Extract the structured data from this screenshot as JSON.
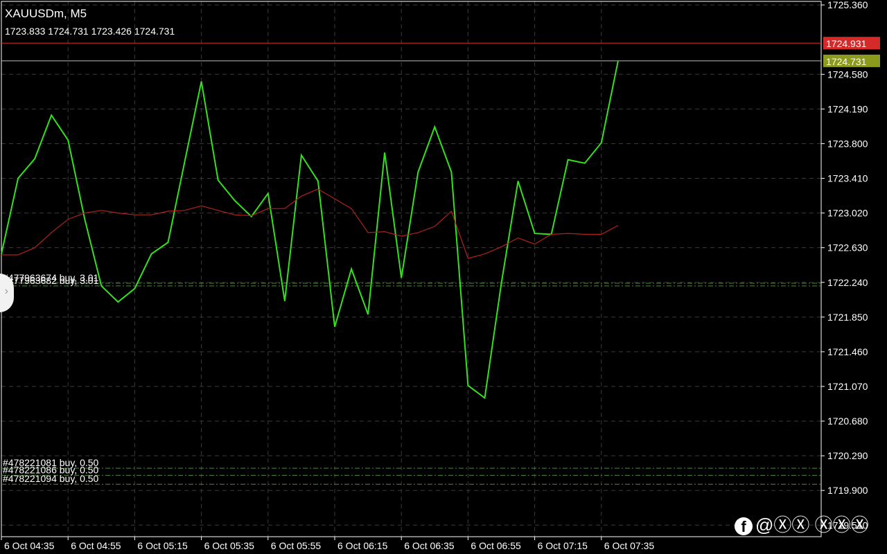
{
  "header": {
    "symbol_timeframe": "XAUUSDm, M5",
    "ohlc": "1723.833 1724.731 1723.426 1724.731"
  },
  "watermark": {
    "fb_glyph": "f",
    "text": "@ⓍⓍ ⓍⓍⓍ"
  },
  "price_tags": [
    {
      "label": "1724.931",
      "value": 1724.931,
      "color": "#d42a2a"
    },
    {
      "label": "1724.731",
      "value": 1724.731,
      "color": "#8c9a1e"
    }
  ],
  "orders": [
    {
      "label": "#477963674 buy, 3.01",
      "price": 1722.23
    },
    {
      "label": "#477963682 buy, 3.01",
      "price": 1722.2
    },
    {
      "label": "#478221081 buy, 0.50",
      "price": 1720.15
    },
    {
      "label": "#478221086 buy, 0.50",
      "price": 1720.07
    },
    {
      "label": "#478221094 buy, 0.50",
      "price": 1719.97
    }
  ],
  "colors": {
    "price_line": "#33e31a",
    "moving_average": "#b2221c",
    "grid": "#3a3a3a",
    "axis": "#ffffff",
    "order_line": "#4e8a3c"
  },
  "chart_data": {
    "type": "line",
    "ylim": [
      1719.38,
      1725.4
    ],
    "y_ticks": [
      "1725.360",
      "1724.580",
      "1724.190",
      "1723.800",
      "1723.410",
      "1723.020",
      "1722.630",
      "1722.240",
      "1721.850",
      "1721.460",
      "1721.070",
      "1720.680",
      "1720.290",
      "1719.900",
      "1719.510"
    ],
    "x_labels": [
      "6 Oct 04:35",
      "6 Oct 04:55",
      "6 Oct 05:15",
      "6 Oct 05:35",
      "6 Oct 05:55",
      "6 Oct 06:15",
      "6 Oct 06:35",
      "6 Oct 06:55",
      "6 Oct 07:15",
      "6 Oct 07:35"
    ],
    "series": [
      {
        "values": [
          1722.56,
          1723.41,
          1723.63,
          1724.12,
          1723.84,
          1722.95,
          1722.2,
          1722.02,
          1722.17,
          1722.56,
          1722.69,
          1723.6,
          1724.5,
          1723.39,
          1723.16,
          1722.98,
          1723.24,
          1722.03,
          1723.67,
          1723.38,
          1721.74,
          1722.39,
          1721.88,
          1723.7,
          1722.29,
          1723.48,
          1723.99,
          1723.48,
          1721.08,
          1720.94,
          1722.23,
          1723.38,
          1722.79,
          1722.78,
          1723.62,
          1723.58,
          1723.81,
          1724.73
        ]
      },
      {
        "values": [
          1722.55,
          1722.55,
          1722.63,
          1722.8,
          1722.95,
          1723.02,
          1723.05,
          1723.02,
          1723.0,
          1723.0,
          1723.04,
          1723.05,
          1723.1,
          1723.05,
          1723.0,
          1722.99,
          1723.07,
          1723.07,
          1723.21,
          1723.29,
          1723.18,
          1723.07,
          1722.8,
          1722.81,
          1722.76,
          1722.8,
          1722.87,
          1723.04,
          1722.51,
          1722.56,
          1722.64,
          1722.74,
          1722.67,
          1722.78,
          1722.79,
          1722.78,
          1722.78,
          1722.88
        ]
      }
    ]
  }
}
